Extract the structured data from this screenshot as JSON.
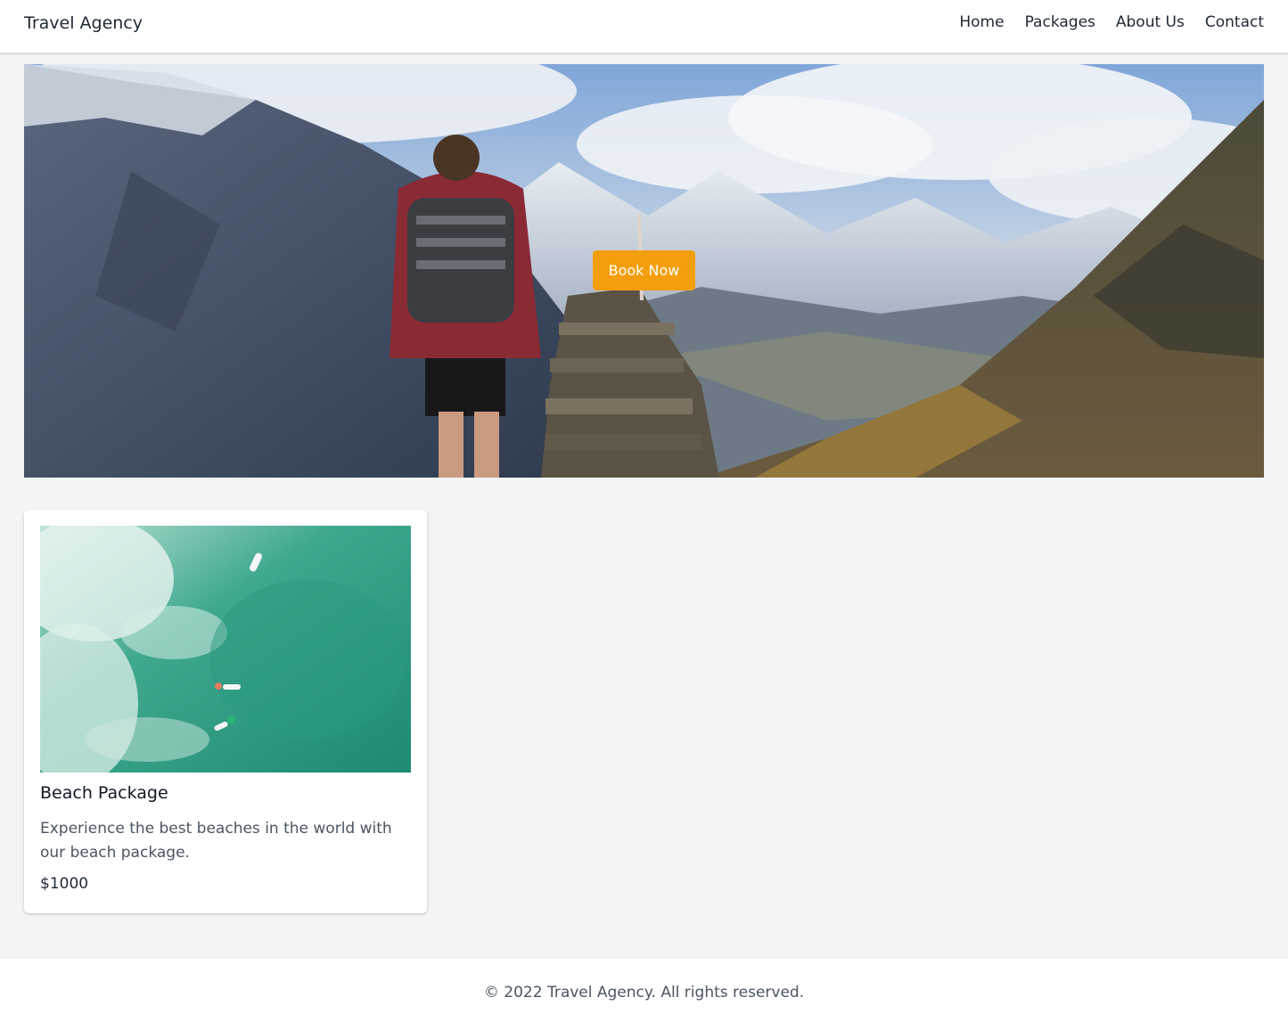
{
  "header": {
    "brand": "Travel Agency",
    "nav": [
      "Home",
      "Packages",
      "About Us",
      "Contact"
    ]
  },
  "hero": {
    "cta_label": "Book Now",
    "cta_color": "#f59e0b"
  },
  "packages": [
    {
      "title": "Beach Package",
      "description": "Experience the best beaches in the world with our beach package.",
      "price": "$1000"
    }
  ],
  "footer": {
    "copyright": "© 2022 Travel Agency. All rights reserved."
  }
}
